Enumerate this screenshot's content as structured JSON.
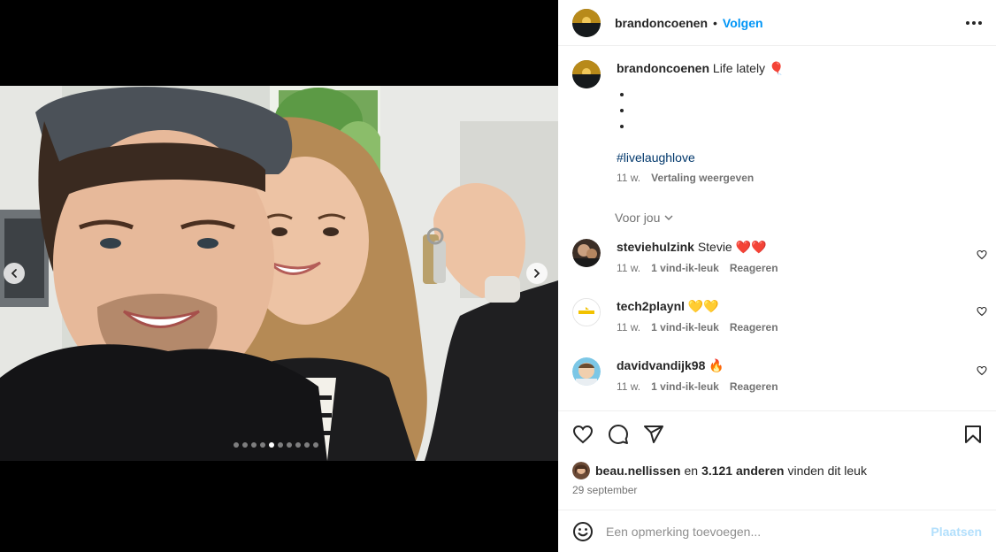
{
  "post": {
    "author": "brandoncoenen",
    "follow_label": "Volgen",
    "separator": "•",
    "caption": {
      "author": "brandoncoenen",
      "text": "Life lately",
      "emoji": "🎈",
      "bullets": [
        "",
        "",
        ""
      ],
      "hashtag": "#livelaughlove",
      "time": "11 w.",
      "translate_label": "Vertaling weergeven"
    },
    "carousel": {
      "slide_count": 10,
      "active_index": 4
    }
  },
  "for_you": {
    "label": "Voor jou"
  },
  "comments": [
    {
      "author": "steviehulzink",
      "text": "Stevie ❤️❤️",
      "time": "11 w.",
      "likes": "1 vind-ik-leuk",
      "reply": "Reageren"
    },
    {
      "author": "tech2playnl",
      "text": "💛💛",
      "time": "11 w.",
      "likes": "1 vind-ik-leuk",
      "reply": "Reageren"
    },
    {
      "author": "davidvandijk98",
      "text": "🔥",
      "time": "11 w.",
      "likes": "1 vind-ik-leuk",
      "reply": "Reageren"
    }
  ],
  "engagement": {
    "liker": "beau.nellissen",
    "and_label": "en",
    "others": "3.121 anderen",
    "suffix": "vinden dit leuk",
    "date": "29 september"
  },
  "composer": {
    "placeholder": "Een opmerking toevoegen...",
    "post_label": "Plaatsen"
  },
  "icons": {
    "like": "heart-icon",
    "comment": "comment-icon",
    "share": "send-icon",
    "save": "bookmark-icon",
    "emoji": "emoji-icon",
    "more": "more-options-icon"
  },
  "colors": {
    "accent": "#0095f6",
    "hashtag": "#00376b",
    "muted": "#737373",
    "post_disabled": "#b2dffc"
  }
}
